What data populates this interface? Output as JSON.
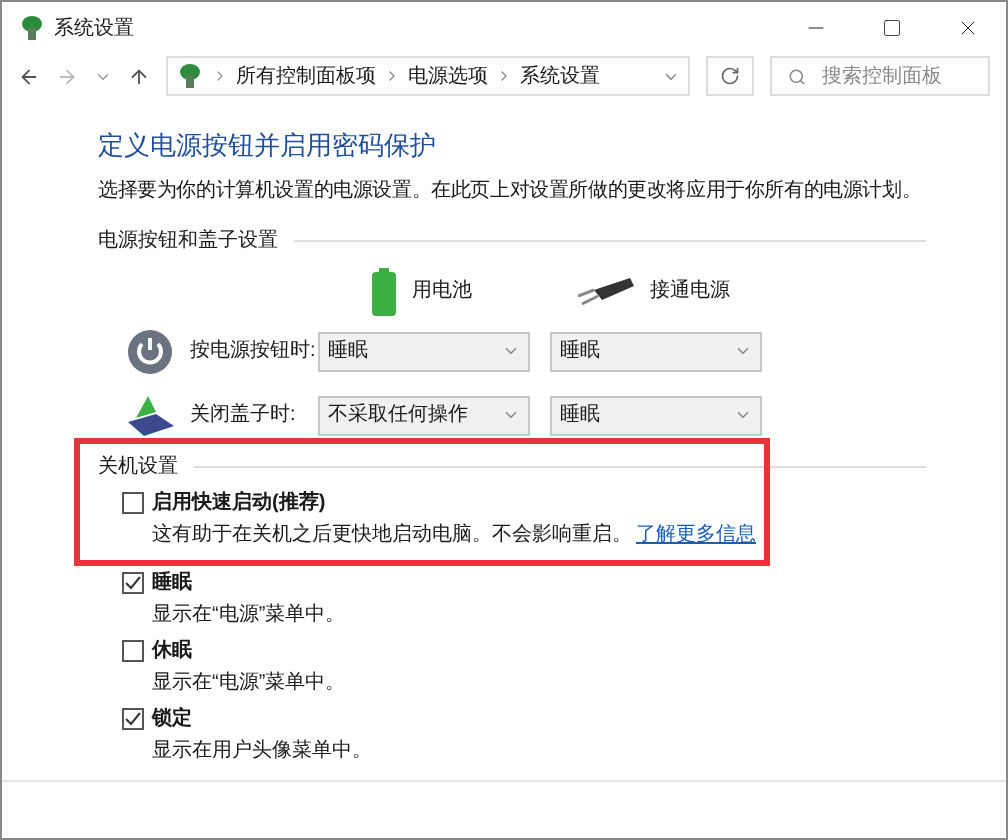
{
  "window": {
    "title": "系统设置"
  },
  "address_bar": {
    "path": [
      "所有控制面板项",
      "电源选项",
      "系统设置"
    ],
    "search": {
      "placeholder": "搜索控制面板"
    }
  },
  "heading": "定义电源按钮并启用密码保护",
  "description": "选择要为你的计算机设置的电源设置。在此页上对设置所做的更改将应用于你所有的电源计划。",
  "power_group": {
    "title": "电源按钮和盖子设置",
    "columns": [
      {
        "label": "用电池",
        "kind": "battery"
      },
      {
        "label": "接通电源",
        "kind": "plug"
      }
    ],
    "rows": [
      {
        "label": "按电源按钮时:",
        "kind": "power",
        "values": [
          "睡眠",
          "睡眠"
        ]
      },
      {
        "label": "关闭盖子时:",
        "kind": "lid",
        "values": [
          "不采取任何操作",
          "睡眠"
        ]
      }
    ]
  },
  "shutdown": {
    "title": "关机设置",
    "highlighted": true,
    "options": [
      {
        "label": "启用快速启动(推荐)",
        "description": "这有助于在关机之后更快地启动电脑。不会影响重启。",
        "link": "了解更多信息",
        "checked": false
      },
      {
        "label": "睡眠",
        "description": "显示在“电源”菜单中。",
        "checked": true
      },
      {
        "label": "休眠",
        "description": "显示在“电源”菜单中。",
        "checked": false
      },
      {
        "label": "锁定",
        "description": "显示在用户头像菜单中。",
        "checked": true
      }
    ]
  }
}
